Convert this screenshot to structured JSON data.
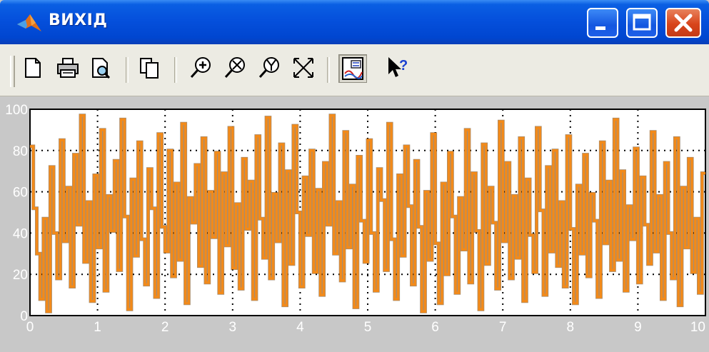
{
  "window": {
    "title": "ВИХІД",
    "accent": "#0550dc",
    "buttons": {
      "minimize": "minimize-icon",
      "maximize": "maximize-icon",
      "close": "close-icon"
    }
  },
  "toolbar": {
    "items": [
      {
        "name": "new-figure-icon",
        "pressed": false
      },
      {
        "name": "print-icon",
        "pressed": false
      },
      {
        "name": "print-preview-icon",
        "pressed": false
      },
      {
        "name": "copy-figure-icon",
        "pressed": false
      },
      {
        "name": "zoom-in-icon",
        "pressed": false
      },
      {
        "name": "zoom-out-icon",
        "pressed": false
      },
      {
        "name": "zoom-y-icon",
        "pressed": false
      },
      {
        "name": "autoscale-icon",
        "pressed": false
      },
      {
        "name": "legend-icon",
        "pressed": true
      },
      {
        "name": "help-cursor-icon",
        "pressed": false
      }
    ]
  },
  "chart_data": {
    "type": "line",
    "step": true,
    "title": "",
    "xlabel": "",
    "ylabel": "",
    "xlim": [
      0,
      10
    ],
    "ylim": [
      0,
      100
    ],
    "xticks": [
      "0",
      "1",
      "2",
      "3",
      "4",
      "5",
      "6",
      "7",
      "8",
      "9",
      "10"
    ],
    "yticks": [
      "0",
      "20",
      "40",
      "60",
      "80",
      "100"
    ],
    "grid": true,
    "background": "#ffffff",
    "series": [
      {
        "color": "#f28a1a",
        "x": [
          0,
          0.05,
          0.1,
          0.15,
          0.2,
          0.25,
          0.3,
          0.35,
          0.4,
          0.45,
          0.5,
          0.55,
          0.6,
          0.65,
          0.7,
          0.75,
          0.8,
          0.85,
          0.9,
          0.95,
          1.0,
          1.05,
          1.1,
          1.15,
          1.2,
          1.25,
          1.3,
          1.35,
          1.4,
          1.45,
          1.5,
          1.55,
          1.6,
          1.65,
          1.7,
          1.75,
          1.8,
          1.85,
          1.9,
          1.95,
          2.0,
          2.05,
          2.1,
          2.15,
          2.2,
          2.25,
          2.3,
          2.35,
          2.4,
          2.45,
          2.5,
          2.55,
          2.6,
          2.65,
          2.7,
          2.75,
          2.8,
          2.85,
          2.9,
          2.95,
          3.0,
          3.05,
          3.1,
          3.15,
          3.2,
          3.25,
          3.3,
          3.35,
          3.4,
          3.45,
          3.5,
          3.55,
          3.6,
          3.65,
          3.7,
          3.75,
          3.8,
          3.85,
          3.9,
          3.95,
          4.0,
          4.05,
          4.1,
          4.15,
          4.2,
          4.25,
          4.3,
          4.35,
          4.4,
          4.45,
          4.5,
          4.55,
          4.6,
          4.65,
          4.7,
          4.75,
          4.8,
          4.85,
          4.9,
          4.95,
          5.0,
          5.05,
          5.1,
          5.15,
          5.2,
          5.25,
          5.3,
          5.35,
          5.4,
          5.45,
          5.5,
          5.55,
          5.6,
          5.65,
          5.7,
          5.75,
          5.8,
          5.85,
          5.9,
          5.95,
          6.0,
          6.05,
          6.1,
          6.15,
          6.2,
          6.25,
          6.3,
          6.35,
          6.4,
          6.45,
          6.5,
          6.55,
          6.6,
          6.65,
          6.7,
          6.75,
          6.8,
          6.85,
          6.9,
          6.95,
          7.0,
          7.05,
          7.1,
          7.15,
          7.2,
          7.25,
          7.3,
          7.35,
          7.4,
          7.45,
          7.5,
          7.55,
          7.6,
          7.65,
          7.7,
          7.75,
          7.8,
          7.85,
          7.9,
          7.95,
          8.0,
          8.05,
          8.1,
          8.15,
          8.2,
          8.25,
          8.3,
          8.35,
          8.4,
          8.45,
          8.5,
          8.55,
          8.6,
          8.65,
          8.7,
          8.75,
          8.8,
          8.85,
          8.9,
          8.95,
          9.0,
          9.05,
          9.1,
          9.15,
          9.2,
          9.25,
          9.3,
          9.35,
          9.4,
          9.45,
          9.5,
          9.55,
          9.6,
          9.65,
          9.7,
          9.75,
          9.8,
          9.85,
          9.9,
          9.95
        ],
        "values": [
          82,
          52,
          30,
          8,
          47,
          2,
          72,
          40,
          18,
          85,
          36,
          62,
          14,
          78,
          44,
          97,
          26,
          55,
          7,
          68,
          33,
          90,
          12,
          58,
          41,
          75,
          22,
          95,
          48,
          3,
          66,
          29,
          84,
          37,
          15,
          71,
          52,
          9,
          88,
          43,
          31,
          80,
          19,
          64,
          27,
          93,
          6,
          57,
          45,
          73,
          24,
          86,
          16,
          60,
          38,
          79,
          11,
          69,
          34,
          91,
          23,
          54,
          13,
          76,
          42,
          65,
          8,
          87,
          47,
          28,
          96,
          18,
          59,
          36,
          83,
          5,
          70,
          25,
          92,
          50,
          14,
          67,
          39,
          80,
          21,
          61,
          10,
          74,
          44,
          97,
          30,
          55,
          17,
          89,
          33,
          63,
          4,
          77,
          46,
          26,
          85,
          40,
          12,
          71,
          56,
          22,
          93,
          37,
          8,
          68,
          29,
          82,
          53,
          15,
          75,
          43,
          2,
          60,
          27,
          88,
          35,
          6,
          64,
          20,
          79,
          48,
          11,
          57,
          32,
          90,
          16,
          69,
          41,
          3,
          83,
          25,
          62,
          45,
          13,
          94,
          36,
          74,
          18,
          58,
          28,
          86,
          7,
          66,
          39,
          21,
          91,
          51,
          10,
          72,
          31,
          80,
          24,
          55,
          14,
          87,
          42,
          6,
          63,
          30,
          78,
          19,
          59,
          46,
          9,
          84,
          35,
          65,
          22,
          95,
          27,
          70,
          12,
          53,
          37,
          81,
          16,
          67,
          44,
          25,
          89,
          31,
          58,
          8,
          74,
          40,
          18,
          86,
          5,
          62,
          33,
          76,
          21,
          47,
          11,
          69
        ]
      }
    ]
  }
}
